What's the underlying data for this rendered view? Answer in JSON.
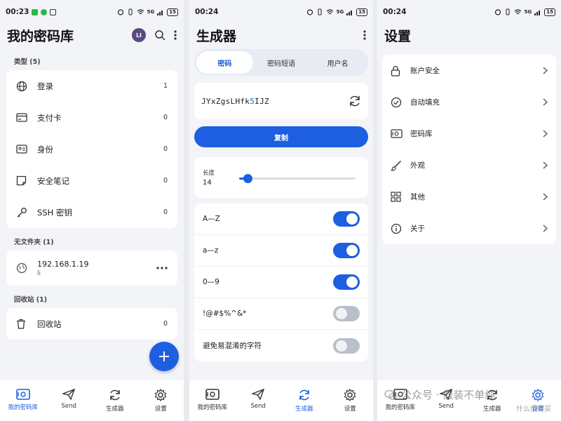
{
  "screen1": {
    "status": {
      "time": "00:23",
      "signal": "5G",
      "battery": "15"
    },
    "title": "我的密码库",
    "avatar": "LI",
    "types_header": "类型 (5)",
    "types": [
      {
        "label": "登录",
        "count": "1",
        "icon": "globe-icon"
      },
      {
        "label": "支付卡",
        "count": "0",
        "icon": "credit-card-icon"
      },
      {
        "label": "身份",
        "count": "0",
        "icon": "id-card-icon"
      },
      {
        "label": "安全笔记",
        "count": "0",
        "icon": "note-icon"
      },
      {
        "label": "SSH 密钥",
        "count": "0",
        "icon": "key-icon"
      }
    ],
    "folder_header": "无文件夹 (1)",
    "folder_item": {
      "title": "192.168.1.19",
      "subtitle": "li"
    },
    "trash_header": "回收站 (1)",
    "trash_item": {
      "label": "回收站",
      "count": "0"
    }
  },
  "screen2": {
    "status": {
      "time": "00:24",
      "signal": "5G",
      "battery": "15"
    },
    "title": "生成器",
    "tabs": [
      "密码",
      "密码短语",
      "用户名"
    ],
    "active_tab": 0,
    "password": {
      "before": "JYxZgsLHfk",
      "highlight": "5",
      "after": "IJZ"
    },
    "copy_label": "复制",
    "length_label": "长度",
    "length_value": "14",
    "length_fraction": 0.07,
    "options": [
      {
        "label": "A—Z",
        "on": true
      },
      {
        "label": "a—z",
        "on": true
      },
      {
        "label": "0—9",
        "on": true
      },
      {
        "label": "!@#$%^&*",
        "on": false
      },
      {
        "label": "避免易混淆的字符",
        "on": false
      }
    ]
  },
  "screen3": {
    "status": {
      "time": "00:24",
      "signal": "5G",
      "battery": "15"
    },
    "title": "设置",
    "items": [
      {
        "label": "账户安全",
        "icon": "lock-icon"
      },
      {
        "label": "自动填充",
        "icon": "check-circle-icon"
      },
      {
        "label": "密码库",
        "icon": "vault-icon"
      },
      {
        "label": "外观",
        "icon": "brush-icon"
      },
      {
        "label": "其他",
        "icon": "grid-icon"
      },
      {
        "label": "关于",
        "icon": "info-icon"
      }
    ]
  },
  "nav": [
    "我的密码库",
    "Send",
    "生成器",
    "设置"
  ],
  "watermark": {
    "text": "公众号 · 假装不单纯",
    "sub": "什么值得买"
  },
  "colors": {
    "accent": "#1d5fe0",
    "background": "#f2f4f8",
    "card": "#ffffff"
  }
}
